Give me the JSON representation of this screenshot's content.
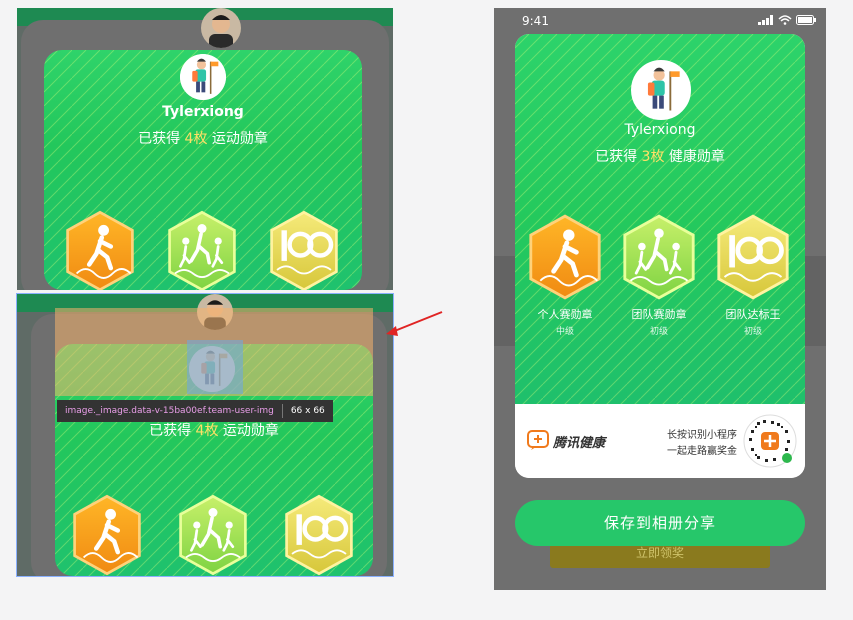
{
  "left_top": {
    "username": "Tylerxiong",
    "earned_prefix": "已获得",
    "earned_count": "4枚",
    "earned_suffix": "运动勋章"
  },
  "left_bottom": {
    "earned_prefix": "已获得",
    "earned_count": "4枚",
    "earned_suffix": "运动勋章",
    "inspector_selector": "image._image.data-v-15ba00ef.team-user-img",
    "inspector_size": "66 x 66"
  },
  "phone": {
    "status_time": "9:41",
    "username": "Tylerxiong",
    "earned_prefix": "已获得",
    "earned_count": "3枚",
    "earned_suffix": "健康勋章",
    "badges": [
      {
        "name": "个人赛勋章",
        "level": "中级",
        "icon": "walker-badge"
      },
      {
        "name": "团队赛勋章",
        "level": "初级",
        "icon": "team-badge"
      },
      {
        "name": "团队达标王",
        "level": "初级",
        "icon": "hundred-badge"
      }
    ],
    "brand_name": "腾讯健康",
    "qr_line1": "长按识别小程序",
    "qr_line2": "一起走路赢奖金",
    "save_button": "保存到相册分享",
    "behind_button": "立即领奖"
  },
  "colors": {
    "green": "#23c75c",
    "orange_badge": "#f6a21c",
    "yellow_accent": "#ffe066",
    "button_green": "#26c76a",
    "inspector_bg": "#333333"
  }
}
